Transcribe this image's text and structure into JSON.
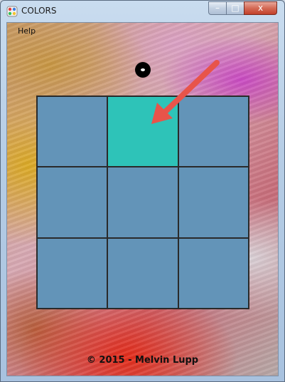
{
  "window": {
    "title": "COLORS",
    "minimize_label": "–",
    "maximize_label": "□",
    "close_label": "x"
  },
  "menu": {
    "help_label": "Help"
  },
  "board": {
    "rows": 3,
    "cols": 3,
    "active_cell": [
      0,
      1
    ],
    "colors": {
      "default": "#6394b8",
      "active": "#2ec3b8"
    }
  },
  "annotation": {
    "arrow_color": "#e8544a"
  },
  "footer": {
    "copyright": "© 2015 - Melvin Lupp"
  }
}
